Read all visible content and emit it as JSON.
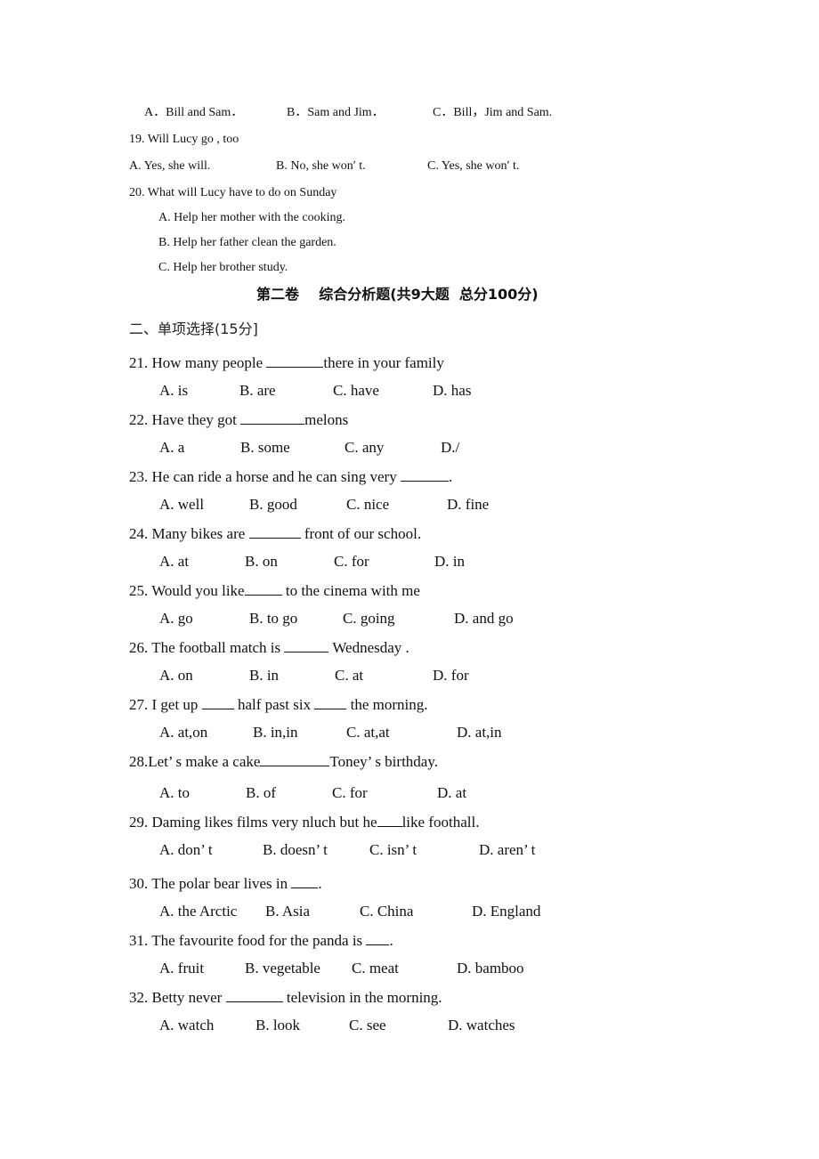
{
  "part1": {
    "q18_options": [
      "A．Bill and Sam．",
      "B．Sam and Jim．",
      "C．Bill，Jim and Sam."
    ],
    "q19": {
      "stem": "19. Will Lucy go , too",
      "options": [
        "A. Yes, she will.",
        "B. No, she won′ t.",
        "C. Yes, she won′ t."
      ]
    },
    "q20": {
      "stem": "20. What will Lucy have to do on Sunday",
      "options": [
        "A. Help her mother with the cooking.",
        "B. Help her father clean the garden.",
        "C. Help her brother study."
      ]
    }
  },
  "part2": {
    "title": "第二卷    综合分析题(共9大题  总分100分)",
    "section": "二、单项选择(15分]",
    "questions": [
      {
        "num": "21.",
        "before": "How many people ",
        "after": "there in your family",
        "options": [
          "A. is",
          "B. are",
          "C. have",
          "D. has"
        ]
      },
      {
        "num": "22.",
        "before": "Have they got ",
        "after": "melons",
        "options": [
          "A. a",
          "B. some",
          "C. any",
          "D./"
        ]
      },
      {
        "num": "23.",
        "before": "He can ride a horse and he can sing very ",
        "after": ".",
        "options": [
          "A. well",
          "B. good",
          "C. nice",
          "D. fine"
        ]
      },
      {
        "num": "24.",
        "before": "Many bikes are ",
        "after": " front of our school.",
        "options": [
          "A. at",
          "B. on",
          "C. for",
          "D. in"
        ]
      },
      {
        "num": "25.",
        "before": "Would you like",
        "after": " to the cinema with me",
        "options": [
          "A. go",
          "B. to go",
          "C. going",
          "D. and go"
        ]
      },
      {
        "num": "26.",
        "before": "The football match is ",
        "after": " Wednesday .",
        "options": [
          "A. on",
          "B. in",
          "C. at",
          "D. for"
        ]
      },
      {
        "num": "27.",
        "before": "I get up ",
        "middle": " half past six ",
        "after": " the morning.",
        "options": [
          "A. at,on",
          "B. in,in",
          "C. at,at",
          "D. at,in"
        ]
      },
      {
        "num": "28.",
        "before": "Let’ s make a cake",
        "after": "Toney’ s birthday.",
        "options": [
          "A. to",
          "B. of",
          "C. for",
          "D. at"
        ]
      },
      {
        "num": "29.",
        "before": "Daming likes films very nluch but he",
        "after": "like foothall.",
        "options": [
          "A. don’ t",
          "B. doesn’ t",
          "C. isn’ t",
          "D. aren’ t"
        ]
      },
      {
        "num": "30.",
        "before": "The polar bear lives in ",
        "after": ".",
        "options": [
          "A. the Arctic",
          "B. Asia",
          "C. China",
          "D. England"
        ]
      },
      {
        "num": "31.",
        "before": "The favourite food for the panda is ",
        "after": ".",
        "options": [
          "A. fruit",
          "B. vegetable",
          "C. meat",
          "D. bamboo"
        ]
      },
      {
        "num": "32.",
        "before": "Betty never ",
        "after": " television in the morning.",
        "options": [
          "A. watch",
          "B. look",
          "C. see",
          "D. watches"
        ]
      }
    ]
  }
}
